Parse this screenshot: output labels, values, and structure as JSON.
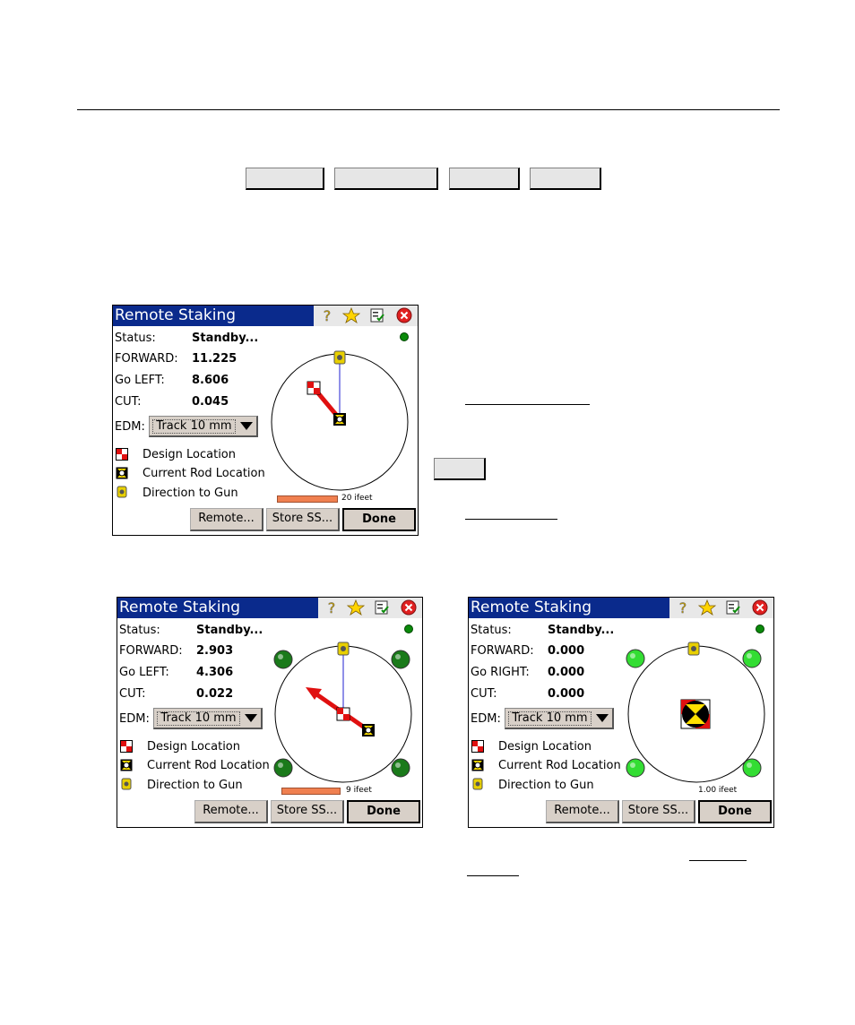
{
  "screens": [
    {
      "title": "Remote Staking",
      "status_label": "Status:",
      "status_value": "Standby...",
      "forward_label": "FORWARD:",
      "forward_value": "11.225",
      "lr_label": "Go LEFT:",
      "lr_value": "8.606",
      "cut_label": "CUT:",
      "cut_value": "0.045",
      "edm_label": "EDM:",
      "edm_value": "Track 10 mm",
      "legend": [
        "Design Location",
        "Current Rod Location",
        "Direction to Gun"
      ],
      "scale_text": "20 ifeet",
      "buttons": {
        "remote": "Remote...",
        "store": "Store SS...",
        "done": "Done"
      }
    },
    {
      "title": "Remote Staking",
      "status_label": "Status:",
      "status_value": "Standby...",
      "forward_label": "FORWARD:",
      "forward_value": "2.903",
      "lr_label": "Go LEFT:",
      "lr_value": "4.306",
      "cut_label": "CUT:",
      "cut_value": "0.022",
      "edm_label": "EDM:",
      "edm_value": "Track 10 mm",
      "legend": [
        "Design Location",
        "Current Rod Location",
        "Direction to Gun"
      ],
      "scale_text": "9 ifeet",
      "buttons": {
        "remote": "Remote...",
        "store": "Store SS...",
        "done": "Done"
      }
    },
    {
      "title": "Remote Staking",
      "status_label": "Status:",
      "status_value": "Standby...",
      "forward_label": "FORWARD:",
      "forward_value": "0.000",
      "lr_label": "Go RIGHT:",
      "lr_value": "0.000",
      "cut_label": "CUT:",
      "cut_value": "0.000",
      "edm_label": "EDM:",
      "edm_value": "Track 10 mm",
      "legend": [
        "Design Location",
        "Current Rod Location",
        "Direction to Gun"
      ],
      "scale_text": "1.00 ifeet",
      "buttons": {
        "remote": "Remote...",
        "store": "Store SS...",
        "done": "Done"
      }
    }
  ],
  "colors": {
    "titlebar": "#0a2a8c",
    "status_dot": "#0a8a0a",
    "dark_green_light": "#1a7a1a",
    "bright_green_light": "#33dd33",
    "arrow": "#e01010",
    "scale_bar": "#f08050"
  }
}
